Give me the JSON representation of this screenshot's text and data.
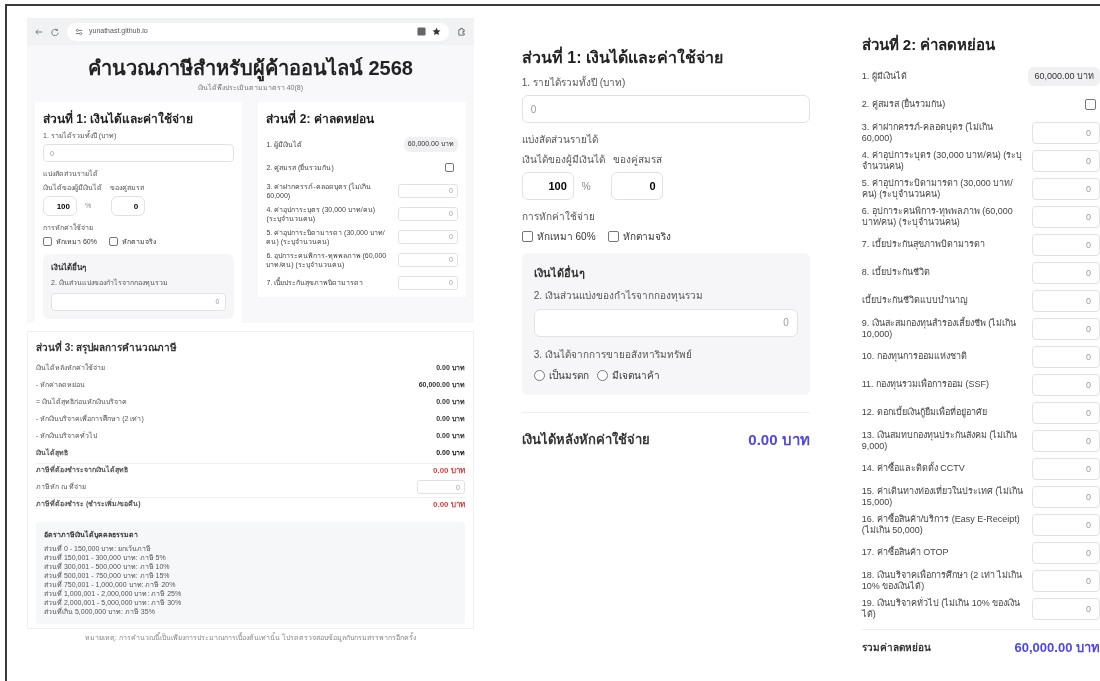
{
  "browser": {
    "url": "yunathast.github.io"
  },
  "page_preview": {
    "title": "คำนวณภาษีสำหรับผู้ค้าออนไลน์ 2568",
    "subtitle": "เงินได้พึงประเมินตามมาตรา 40(8)",
    "section1": {
      "title": "ส่วนที่ 1: เงินได้และค่าใช้จ่าย",
      "income_label": "1. รายได้รวมทั้งปี (บาท)",
      "income_placeholder": "0",
      "split_label": "แบ่งสัดส่วนรายได้",
      "own_label": "เงินได้ของผู้มีเงินได้",
      "spouse_label": "ของคู่สมรส",
      "own_value": "100",
      "percent_sign": "%",
      "spouse_value": "0",
      "expense_label": "การหักค่าใช้จ่าย",
      "checkboxes": [
        {
          "label": "หักเหมา 60%",
          "checked": false
        },
        {
          "label": "หักตามจริง",
          "checked": false
        }
      ],
      "other": {
        "title": "เงินได้อื่นๆ",
        "field2_label": "2. เงินส่วนแบ่งของกำไรจากกองทุนรวม",
        "field2_placeholder": "0"
      }
    },
    "section2": {
      "title": "ส่วนที่ 2: ค่าลดหย่อน",
      "items": [
        {
          "label": "1. ผู้มีเงินได้",
          "kind": "amount",
          "value": "60,000.00 บาท"
        },
        {
          "label": "2. คู่สมรส (ยื่นรวมกัน)",
          "kind": "checkbox",
          "checked": false
        },
        {
          "label": "3. ค่าฝากครรภ์-คลอดบุตร (ไม่เกิน 60,000)",
          "kind": "input",
          "placeholder": "0"
        },
        {
          "label": "4. ค่าอุปการะบุตร (30,000 บาท/คน) (ระบุจำนวนคน)",
          "kind": "input",
          "placeholder": "0"
        },
        {
          "label": "5. ค่าอุปการะบิดามารดา (30,000 บาท/คน) (ระบุจำนวนคน)",
          "kind": "input",
          "placeholder": "0"
        },
        {
          "label": "6. อุปการะคนพิการ-ทุพพลภาพ (60,000 บาท/คน) (ระบุจำนวนคน)",
          "kind": "input",
          "placeholder": "0"
        },
        {
          "label": "7. เบี้ยประกันสุขภาพบิดามารดา",
          "kind": "input",
          "placeholder": "0"
        }
      ]
    },
    "section3": {
      "title": "ส่วนที่ 3: สรุปผลการคำนวณภาษี",
      "rows": [
        {
          "label": "เงินได้หลังหักค่าใช้จ่าย",
          "kind": "normal",
          "value": "0.00 บาท"
        },
        {
          "label": "- หักค่าลดหย่อน",
          "kind": "normal",
          "value": "60,000.00 บาท"
        },
        {
          "label": "= เงินได้สุทธิก่อนหักเงินบริจาค",
          "kind": "normal",
          "value": "0.00 บาท"
        },
        {
          "label": "- หักเงินบริจาคเพื่อการศึกษา (2 เท่า)",
          "kind": "normal",
          "value": "0.00 บาท"
        },
        {
          "label": "- หักเงินบริจาคทั่วไป",
          "kind": "normal",
          "value": "0.00 บาท"
        },
        {
          "label": "เงินได้สุทธิ",
          "kind": "bold",
          "value": "0.00 บาท"
        },
        {
          "label": "ภาษีที่ต้องชำระจากเงินได้สุทธิ",
          "kind": "tax",
          "value": "0.00 บาท"
        },
        {
          "label": "ภาษีหัก ณ ที่จ่าย",
          "kind": "field",
          "placeholder": "0"
        },
        {
          "label": "ภาษีที่ต้องชำระ (ชำระเพิ่ม/ขอคืน)",
          "kind": "tax",
          "value": "0.00 บาท"
        }
      ],
      "rates": {
        "title": "อัตราภาษีเงินได้บุคคลธรรมดา",
        "lines": [
          "ส่วนที่ 0 - 150,000 บาท: ยกเว้นภาษี",
          "ส่วนที่ 150,001 - 300,000 บาท: ภาษี 5%",
          "ส่วนที่ 300,001 - 500,000 บาท: ภาษี 10%",
          "ส่วนที่ 500,001 - 750,000 บาท: ภาษี 15%",
          "ส่วนที่ 750,001 - 1,000,000 บาท: ภาษี 20%",
          "ส่วนที่ 1,000,001 - 2,000,000 บาท: ภาษี 25%",
          "ส่วนที่ 2,000,001 - 5,000,000 บาท: ภาษี 30%",
          "ส่วนที่เกิน 5,000,000 บาท: ภาษี 35%"
        ]
      }
    },
    "footer": "หมายเหตุ: การคำนวณนี้เป็นเพียงการประมาณการเบื้องต้นเท่านั้น โปรดตรวจสอบข้อมูลกับกรมสรรพากรอีกครั้ง"
  },
  "section1_view": {
    "title": "ส่วนที่ 1: เงินได้และค่าใช้จ่าย",
    "income_label": "1. รายได้รวมทั้งปี (บาท)",
    "income_placeholder": "0",
    "split_label": "แบ่งสัดส่วนรายได้",
    "own_label": "เงินได้ของผู้มีเงินได้",
    "spouse_label": "ของคู่สมรส",
    "own_value": "100",
    "percent_sign": "%",
    "spouse_value": "0",
    "expense_label": "การหักค่าใช้จ่าย",
    "checkboxes": [
      {
        "label": "หักเหมา 60%",
        "checked": false
      },
      {
        "label": "หักตามจริง",
        "checked": false
      }
    ],
    "other": {
      "title": "เงินได้อื่นๆ",
      "field2_label": "2. เงินส่วนแบ่งของกำไรจากกองทุนรวม",
      "field2_placeholder": "0",
      "field3_label": "3. เงินได้จากการขายอสังหาริมทรัพย์",
      "radios": [
        {
          "label": "เป็นมรดก",
          "selected": false
        },
        {
          "label": "มีเจตนาค้า",
          "selected": false
        }
      ]
    },
    "result_label": "เงินได้หลังหักค่าใช้จ่าย",
    "result_value": "0.00 บาท"
  },
  "section2_view": {
    "title": "ส่วนที่ 2: ค่าลดหย่อน",
    "items": [
      {
        "label": "1. ผู้มีเงินได้",
        "kind": "amount",
        "value": "60,000.00 บาท"
      },
      {
        "label": "2. คู่สมรส (ยื่นรวมกัน)",
        "kind": "checkbox",
        "checked": false
      },
      {
        "label": "3. ค่าฝากครรภ์-คลอดบุตร (ไม่เกิน 60,000)",
        "kind": "input",
        "placeholder": "0"
      },
      {
        "label": "4. ค่าอุปการะบุตร (30,000 บาท/คน) (ระบุจำนวนคน)",
        "kind": "input",
        "placeholder": "0"
      },
      {
        "label": "5. ค่าอุปการะบิดามารดา (30,000 บาท/คน) (ระบุจำนวนคน)",
        "kind": "input",
        "placeholder": "0"
      },
      {
        "label": "6. อุปการะคนพิการ-ทุพพลภาพ (60,000 บาท/คน) (ระบุจำนวนคน)",
        "kind": "input",
        "placeholder": "0"
      },
      {
        "label": "7. เบี้ยประกันสุขภาพบิดามารดา",
        "kind": "input",
        "placeholder": "0"
      },
      {
        "label": "8. เบี้ยประกันชีวิต",
        "kind": "input",
        "placeholder": "0"
      },
      {
        "label": "เบี้ยประกันชีวิตแบบบำนาญ",
        "kind": "input",
        "placeholder": "0"
      },
      {
        "label": "9. เงินสะสมกองทุนสำรองเลี้ยงชีพ (ไม่เกิน 10,000)",
        "kind": "input",
        "placeholder": "0"
      },
      {
        "label": "10. กองทุนการออมแห่งชาติ",
        "kind": "input",
        "placeholder": "0"
      },
      {
        "label": "11. กองทุนรวมเพื่อการออม (SSF)",
        "kind": "input",
        "placeholder": "0"
      },
      {
        "label": "12. ดอกเบี้ยเงินกู้ยืมเพื่อที่อยู่อาศัย",
        "kind": "input",
        "placeholder": "0"
      },
      {
        "label": "13. เงินสมทบกองทุนประกันสังคม (ไม่เกิน 9,000)",
        "kind": "input",
        "placeholder": "0"
      },
      {
        "label": "14. ค่าซื้อและติดตั้ง CCTV",
        "kind": "input",
        "placeholder": "0"
      },
      {
        "label": "15. ค่าเดินทางท่องเที่ยวในประเทศ (ไม่เกิน 15,000)",
        "kind": "input",
        "placeholder": "0"
      },
      {
        "label": "16. ค่าซื้อสินค้า/บริการ (Easy E-Receipt) (ไม่เกิน 50,000)",
        "kind": "input",
        "placeholder": "0"
      },
      {
        "label": "17. ค่าซื้อสินค้า OTOP",
        "kind": "input",
        "placeholder": "0"
      },
      {
        "label": "18. เงินบริจาคเพื่อการศึกษา (2 เท่า ไม่เกิน 10% ของเงินได้)",
        "kind": "input",
        "placeholder": "0"
      },
      {
        "label": "19. เงินบริจาคทั่วไป (ไม่เกิน 10% ของเงินได้)",
        "kind": "input",
        "placeholder": "0"
      }
    ],
    "total_label": "รวมค่าลดหย่อน",
    "total_value": "60,000.00 บาท"
  }
}
